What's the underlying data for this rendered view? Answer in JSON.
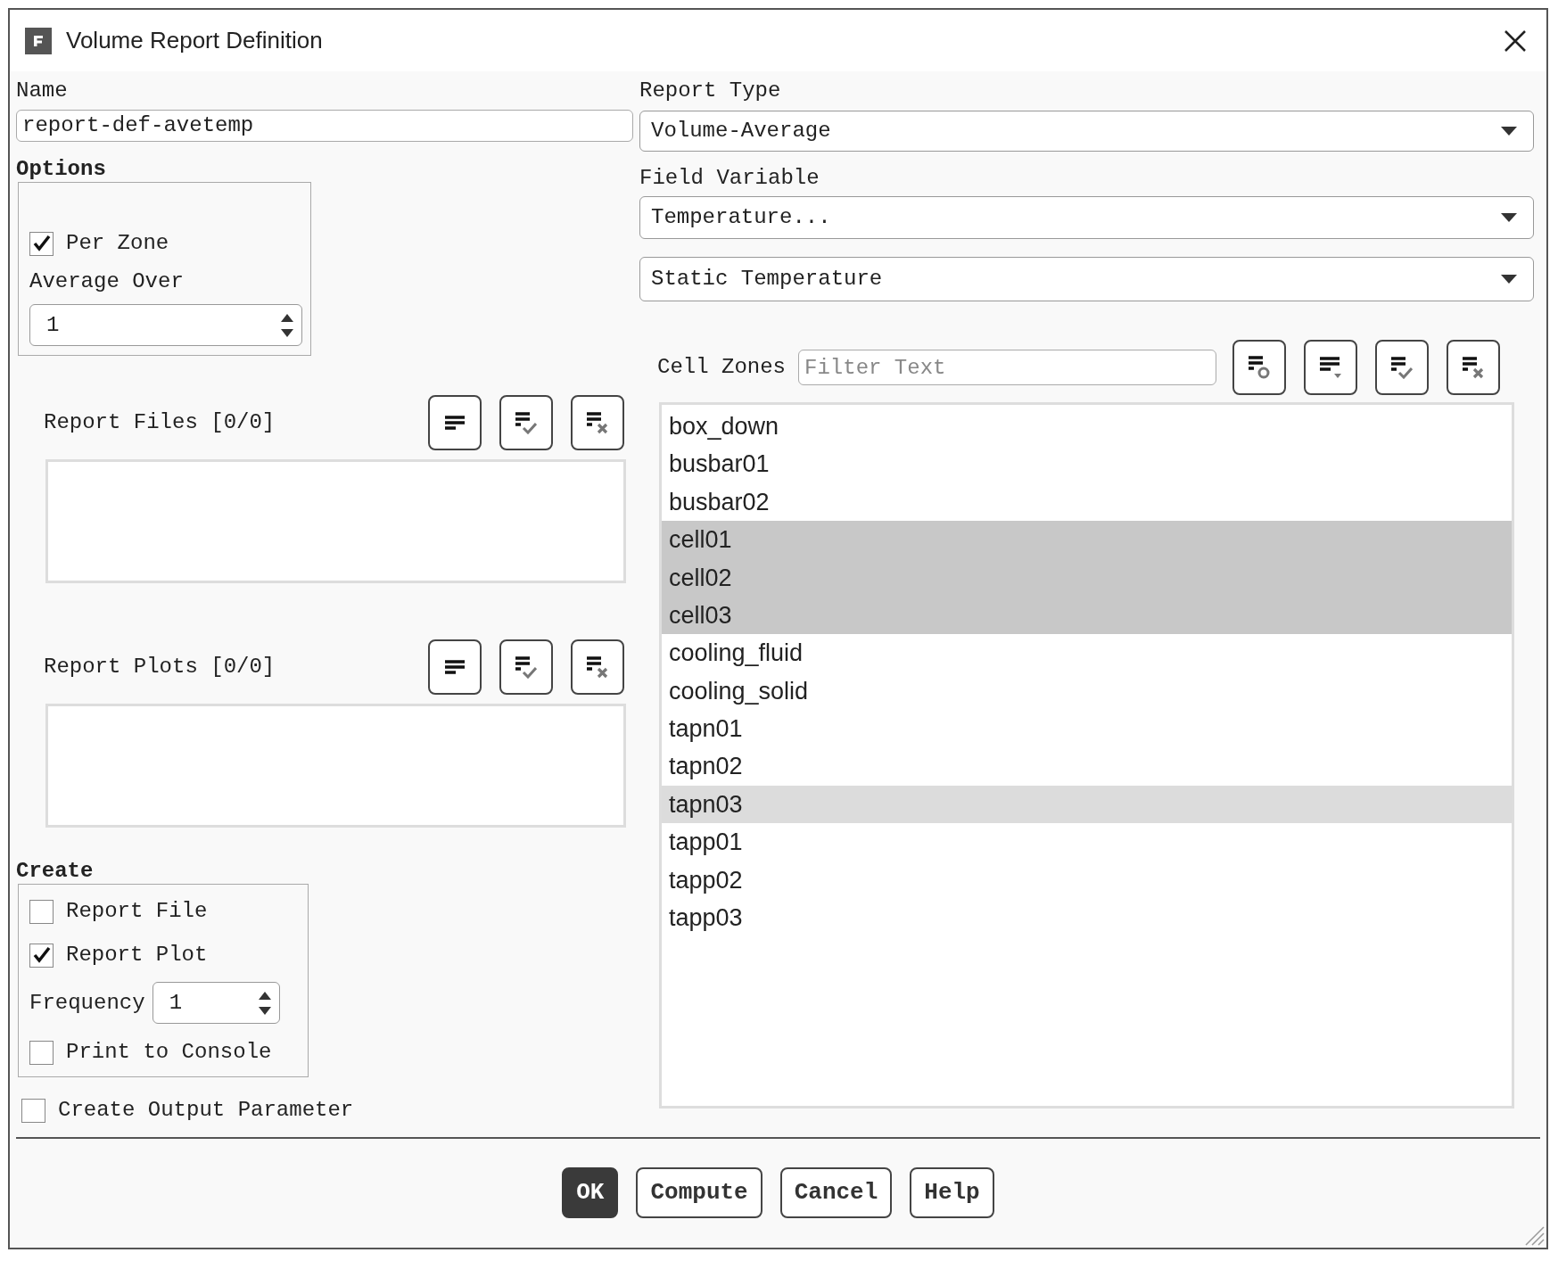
{
  "window": {
    "title": "Volume Report Definition"
  },
  "name": {
    "label": "Name",
    "value": "report-def-avetemp"
  },
  "options": {
    "label": "Options",
    "per_zone": {
      "label": "Per Zone",
      "checked": true
    },
    "average_over": {
      "label": "Average Over",
      "value": "1"
    }
  },
  "report_files": {
    "label": "Report Files [0/0]"
  },
  "report_plots": {
    "label": "Report Plots [0/0]"
  },
  "create": {
    "label": "Create",
    "report_file": {
      "label": "Report File",
      "checked": false
    },
    "report_plot": {
      "label": "Report Plot",
      "checked": true
    },
    "frequency": {
      "label": "Frequency",
      "value": "1"
    },
    "print_to_console": {
      "label": "Print to Console",
      "checked": false
    }
  },
  "create_output_parameter": {
    "label": "Create Output Parameter",
    "checked": false
  },
  "report_type": {
    "label": "Report Type",
    "value": "Volume-Average"
  },
  "field_variable": {
    "label": "Field Variable",
    "value": "Temperature...",
    "sub_value": "Static Temperature"
  },
  "cell_zones": {
    "label": "Cell Zones",
    "filter_placeholder": "Filter Text",
    "items": [
      {
        "label": "box_down",
        "selected": false,
        "highlighted": false
      },
      {
        "label": "busbar01",
        "selected": false,
        "highlighted": false
      },
      {
        "label": "busbar02",
        "selected": false,
        "highlighted": false
      },
      {
        "label": "cell01",
        "selected": true,
        "highlighted": false
      },
      {
        "label": "cell02",
        "selected": true,
        "highlighted": false
      },
      {
        "label": "cell03",
        "selected": true,
        "highlighted": false
      },
      {
        "label": "cooling_fluid",
        "selected": false,
        "highlighted": false
      },
      {
        "label": "cooling_solid",
        "selected": false,
        "highlighted": false
      },
      {
        "label": "tapn01",
        "selected": false,
        "highlighted": false
      },
      {
        "label": "tapn02",
        "selected": false,
        "highlighted": false
      },
      {
        "label": "tapn03",
        "selected": false,
        "highlighted": true
      },
      {
        "label": "tapp01",
        "selected": false,
        "highlighted": false
      },
      {
        "label": "tapp02",
        "selected": false,
        "highlighted": false
      },
      {
        "label": "tapp03",
        "selected": false,
        "highlighted": false
      }
    ]
  },
  "buttons": [
    {
      "label": "OK",
      "default": true
    },
    {
      "label": "Compute",
      "default": false
    },
    {
      "label": "Cancel",
      "default": false
    },
    {
      "label": "Help",
      "default": false
    }
  ]
}
